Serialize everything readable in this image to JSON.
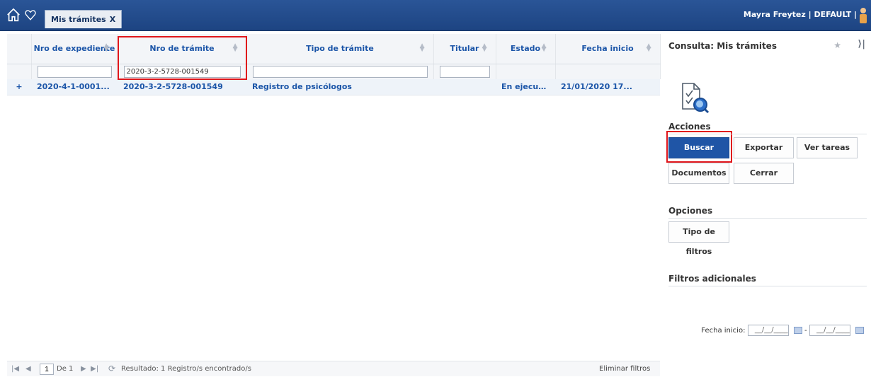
{
  "header": {
    "tab_label": "Mis trámites",
    "tab_close": "X",
    "user_info": "Mayra Freytez | DEFAULT |"
  },
  "icons": {
    "home": "home-icon",
    "favorites": "heart-icon",
    "user": "user-icon",
    "pin": "star-icon",
    "collapse": "collapse-right-icon",
    "query": "document-search-icon",
    "calendar": "calendar-icon"
  },
  "grid": {
    "columns": [
      "Nro de expediente",
      "Nro de trámite",
      "Tipo de trámite",
      "Titular",
      "Estado",
      "Fecha inicio"
    ],
    "filters": {
      "expediente": "",
      "tramite": "2020-3-2-5728-001549",
      "tipo": "",
      "titular": ""
    },
    "rows": [
      {
        "expand": "+",
        "expediente": "2020-4-1-0001...",
        "tramite": "2020-3-2-5728-001549",
        "tipo": "Registro de psicólogos",
        "titular": "",
        "estado": "En ejecuci...",
        "fecha": "21/01/2020 17..."
      }
    ]
  },
  "pager": {
    "first": "|◀",
    "prev": "◀",
    "page": "1",
    "of_label": "De 1",
    "next": "▶",
    "last": "▶|",
    "refresh": "⟳",
    "result": "Resultado: 1 Registro/s encontrado/s",
    "clear_filters": "Eliminar filtros"
  },
  "panel": {
    "title": "Consulta: Mis trámites",
    "actions_title": "Acciones",
    "buttons": {
      "buscar": "Buscar",
      "exportar": "Exportar",
      "ver_tareas": "Ver tareas",
      "documentos": "Documentos",
      "cerrar": "Cerrar"
    },
    "options_title": "Opciones",
    "filter_type_button": "Tipo de filtros",
    "extra_filters_title": "Filtros adicionales",
    "date_label": "Fecha inicio:",
    "date_from": "__/__/____",
    "date_sep": "-",
    "date_to": "__/__/____"
  },
  "colors": {
    "header_bg": "#1d4482",
    "link_blue": "#1b55a8",
    "primary_button": "#1f55a6",
    "highlight": "#e0161b"
  }
}
